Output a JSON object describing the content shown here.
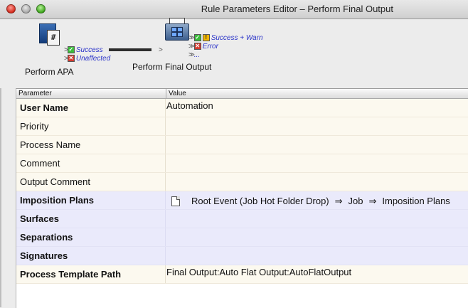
{
  "window": {
    "title": "Rule Parameters Editor – Perform Final Output"
  },
  "icons": {
    "close": "close-window-icon",
    "minimize": "minimize-window-icon",
    "zoom": "zoom-window-icon",
    "apa": "perform-apa-icon",
    "final_output": "perform-final-output-icon",
    "document": "document-icon",
    "arrow": "double-arrow-icon"
  },
  "flow": {
    "nodes": [
      {
        "label": "Perform APA"
      },
      {
        "label": "Perform Final Output"
      }
    ],
    "apa_outputs": [
      "Success",
      "Unaffected"
    ],
    "final_outputs": [
      "Success + Warn",
      "Error",
      "..."
    ]
  },
  "table": {
    "columns": [
      "Parameter",
      "Value"
    ],
    "rows": [
      {
        "param": "User Name",
        "value": "Automation"
      },
      {
        "param": "Priority",
        "value": ""
      },
      {
        "param": "Process Name",
        "value": ""
      },
      {
        "param": "Comment",
        "value": ""
      },
      {
        "param": "Output Comment",
        "value": ""
      },
      {
        "param": "Imposition Plans",
        "path": [
          "Root Event (Job Hot Folder Drop)",
          "Job",
          "Imposition Plans"
        ]
      },
      {
        "param": "Surfaces",
        "value": ""
      },
      {
        "param": "Separations",
        "value": ""
      },
      {
        "param": "Signatures",
        "value": ""
      },
      {
        "param": "Process Template Path",
        "value": "Final Output:Auto Flat Output:AutoFlatOutput"
      }
    ]
  },
  "colors": {
    "status_text": "#2c35c9",
    "row_cream": "#fcf9ef",
    "row_lavender": "#eaeafb",
    "success": "#3bbd3b",
    "error": "#d43a2f",
    "warn": "#f2b600"
  }
}
